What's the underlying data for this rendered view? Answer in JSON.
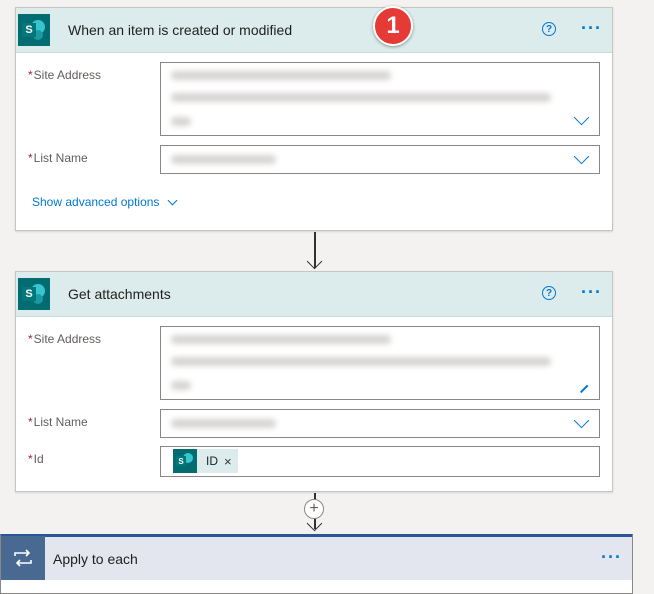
{
  "trigger": {
    "title": "When an item is created or modified",
    "fields": {
      "site_address_label": "Site Address",
      "list_name_label": "List Name"
    },
    "advanced_label": "Show advanced options",
    "badge": "1"
  },
  "action": {
    "title": "Get attachments",
    "fields": {
      "site_address_label": "Site Address",
      "list_name_label": "List Name",
      "id_label": "Id",
      "id_token": "ID",
      "token_remove": "×"
    }
  },
  "loop": {
    "title": "Apply to each"
  },
  "common": {
    "required_mark": "*",
    "more_glyph": "···",
    "help_glyph": "?",
    "add_glyph": "+"
  },
  "colors": {
    "sharepoint_header": "#dcecec",
    "sharepoint_brand": "#036c70",
    "accent": "#0078d4",
    "badge": "#e63a36",
    "loop_brand": "#486991"
  },
  "icons": [
    "sharepoint-icon",
    "help-icon",
    "more-icon",
    "chevron-down-icon",
    "loop-icon",
    "add-icon",
    "step-badge"
  ]
}
